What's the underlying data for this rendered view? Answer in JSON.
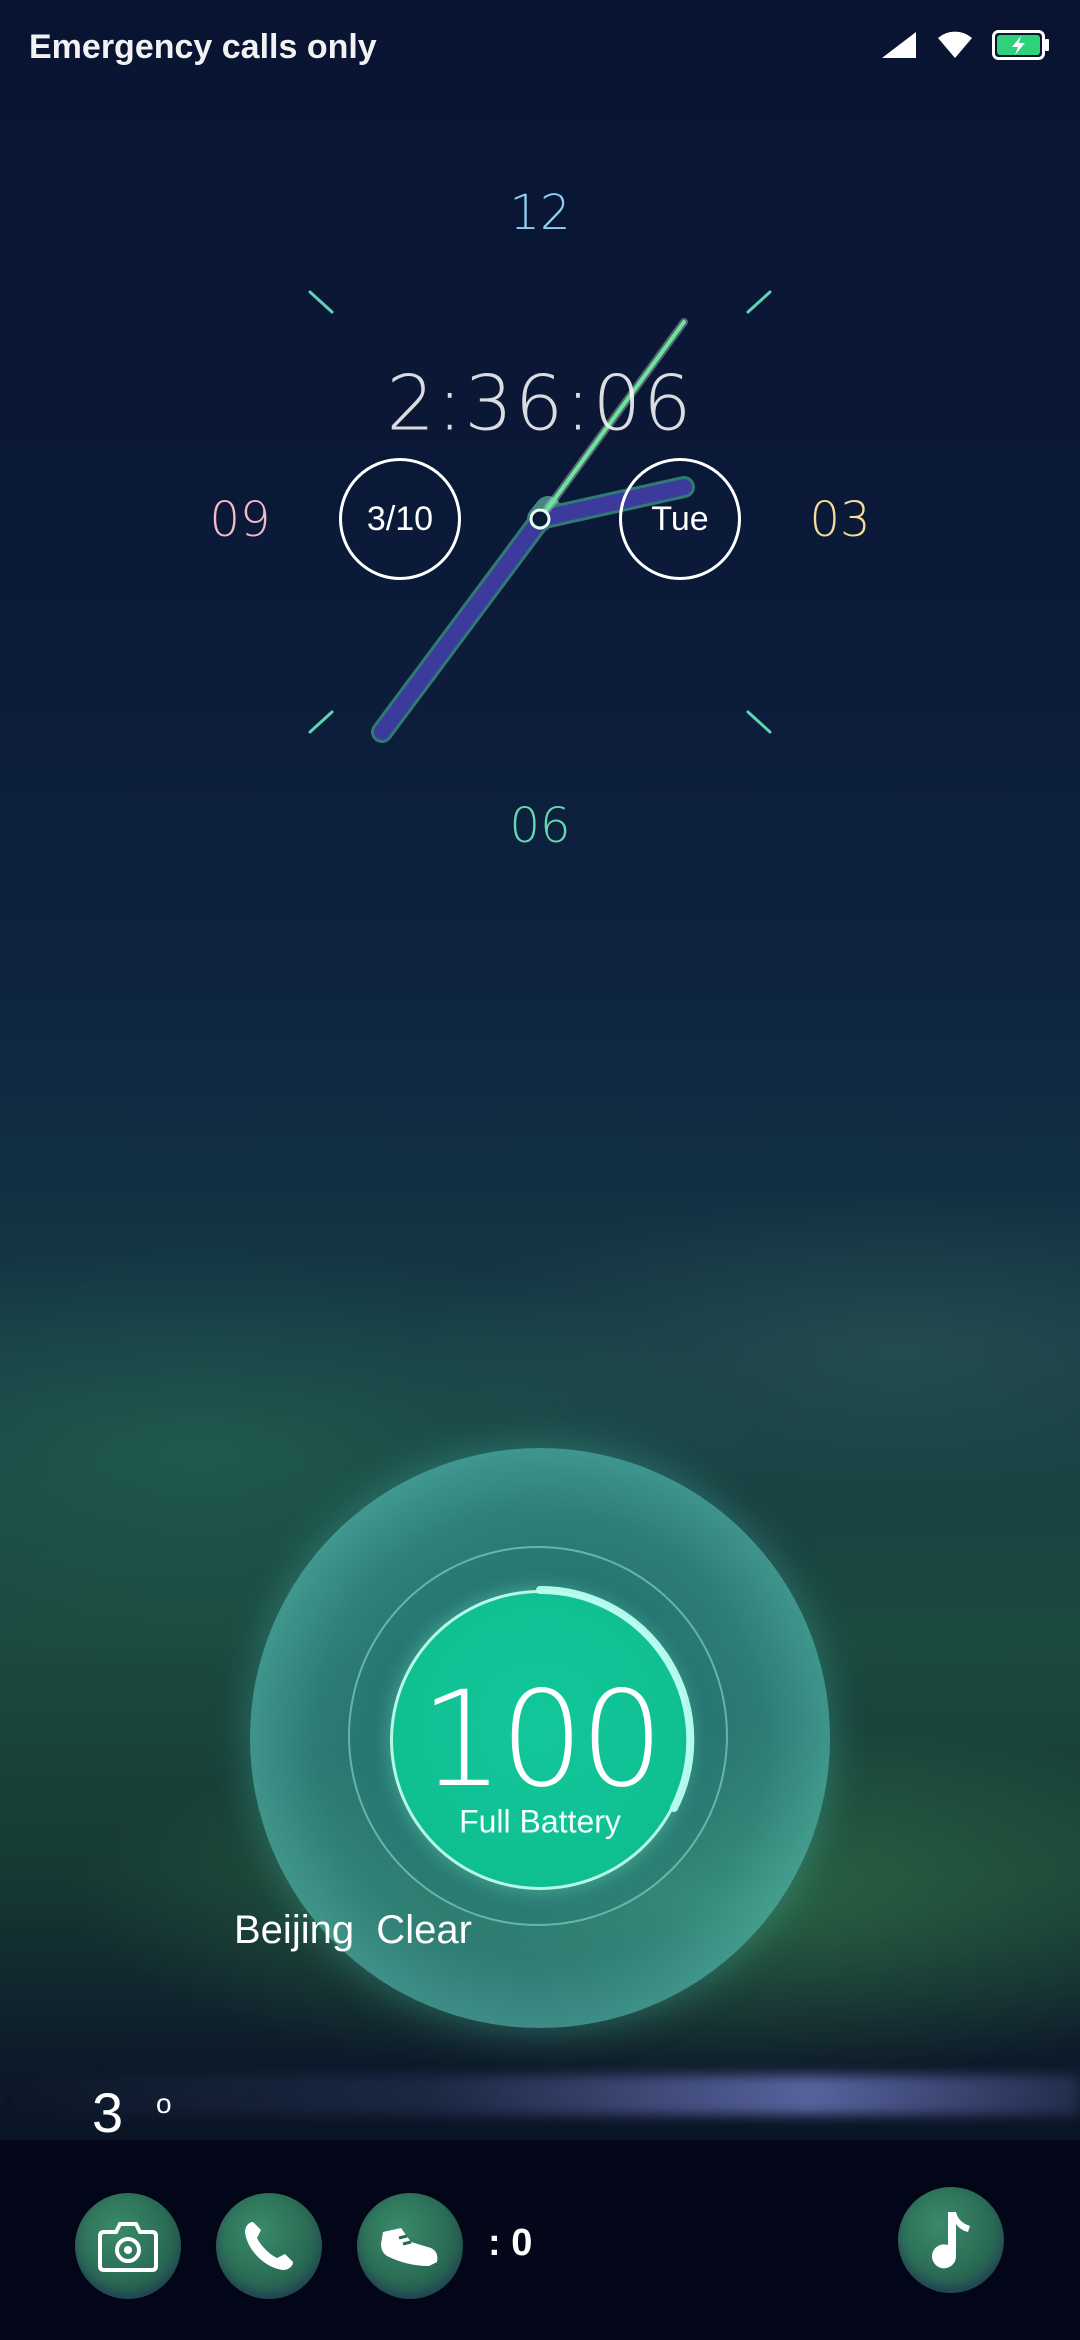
{
  "status_bar": {
    "carrier_text": "Emergency calls only",
    "battery_color": "#2fd27a"
  },
  "clock": {
    "hour_labels": {
      "twelve": "12",
      "three": "03",
      "six": "06",
      "nine": "09"
    },
    "hour_label_colors": {
      "twelve": "#8fd0f0",
      "three": "#f3dc9a",
      "six": "#66d8b0",
      "nine": "#f4b8c8"
    },
    "digital_time": "2:36:06",
    "date": "3/10",
    "weekday": "Tue",
    "hand_color": "#3d3a9e",
    "second_hand_color": "#6ee39a"
  },
  "battery": {
    "level": "100",
    "status_label": "Full Battery",
    "accent_color": "#12c79a"
  },
  "weather": {
    "city": "Beijing",
    "condition": "Clear",
    "display": "Beijing  Clear",
    "temperature": "3",
    "degree_symbol": "o"
  },
  "dock": {
    "items": [
      {
        "icon": "camera-icon"
      },
      {
        "icon": "phone-icon"
      },
      {
        "icon": "shoe-icon"
      },
      {
        "icon": "music-note-icon"
      }
    ],
    "step_count": ": 0"
  }
}
